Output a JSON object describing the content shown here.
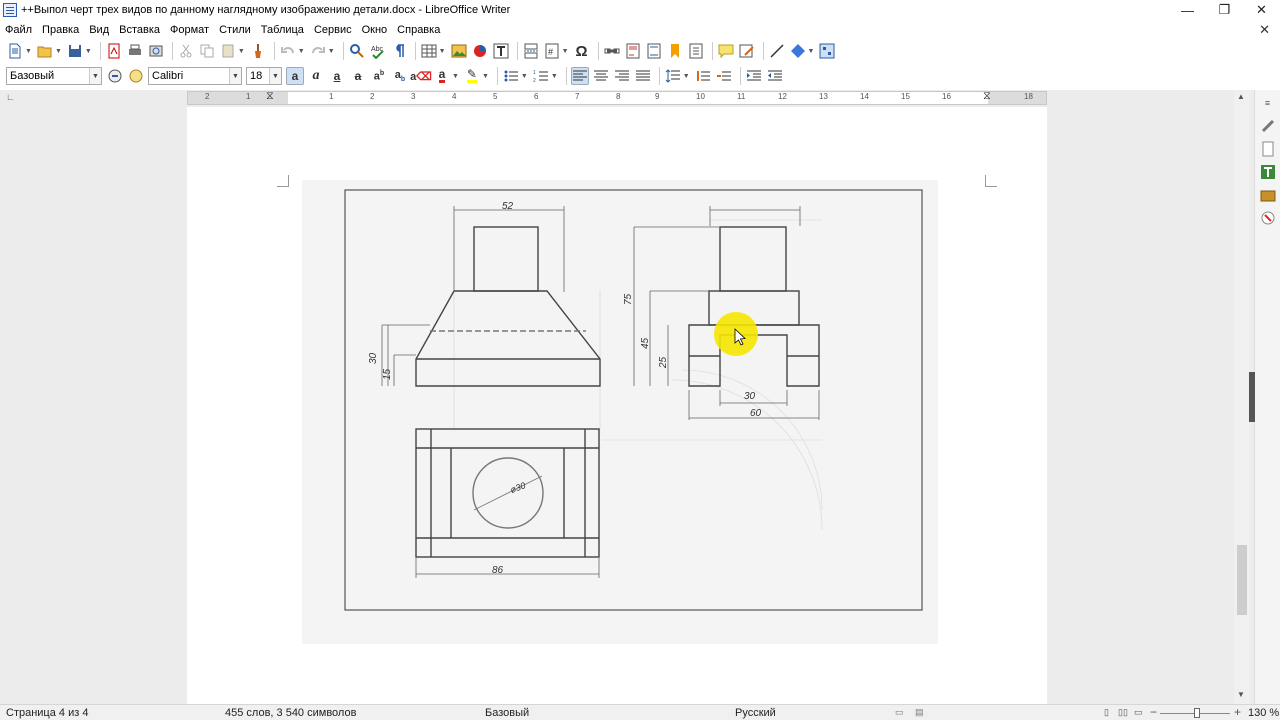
{
  "window": {
    "title": "++Выпол черт трех видов по данному наглядному изображению детали.docx - LibreOffice Writer",
    "minimize": "—",
    "restore": "❐",
    "close": "✕"
  },
  "menu": {
    "items": [
      "Файл",
      "Правка",
      "Вид",
      "Вставка",
      "Формат",
      "Стили",
      "Таблица",
      "Сервис",
      "Окно",
      "Справка"
    ],
    "close": "✕"
  },
  "formatting": {
    "paragraph_style": "Базовый",
    "font_name": "Calibri",
    "font_size": "18"
  },
  "ruler": {
    "ticks": [
      "2",
      "1",
      "1",
      "2",
      "3",
      "4",
      "5",
      "6",
      "7",
      "8",
      "9",
      "10",
      "11",
      "12",
      "13",
      "14",
      "15",
      "16",
      "17",
      "18"
    ]
  },
  "drawing": {
    "dimensions": {
      "front_top_width": "52",
      "front_height": "30",
      "front_base_height": "15",
      "side_total_height": "75",
      "side_mid_height": "45",
      "side_base_height": "25",
      "side_slot_width": "30",
      "side_width": "60",
      "top_hole_diameter": "ø30",
      "top_width": "86"
    }
  },
  "status": {
    "page": "Страница 4 из 4",
    "words": "455 слов, 3 540 символов",
    "style": "Базовый",
    "language": "Русский",
    "zoom": "130 %"
  },
  "colors": {
    "highlight_cursor": "#f5e600",
    "chrome_bg": "#ffffff",
    "workspace_bg": "#ececec"
  }
}
